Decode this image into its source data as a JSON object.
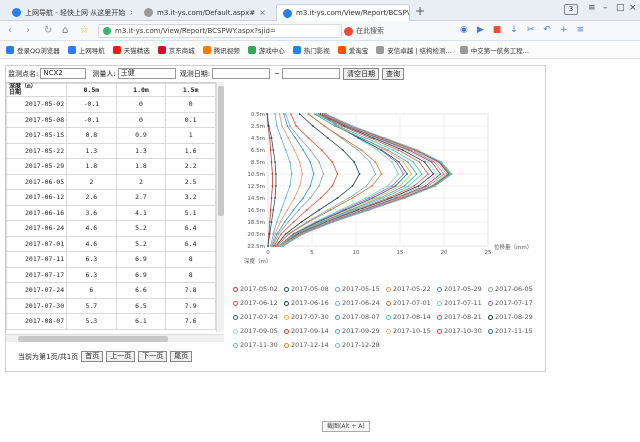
{
  "browser": {
    "tabs": [
      {
        "label": "上网导航 - 轻快上网 从这里开始",
        "icon": "globe-icon",
        "color": "#2b7de9"
      },
      {
        "label": "m3.it-ys.com/Default.aspx#",
        "icon": "page-icon",
        "color": "#777777"
      },
      {
        "label": "m3.it-ys.com/View/Report/BCSPV",
        "icon": "page-icon",
        "color": "#2b7de9"
      }
    ],
    "badge": "3",
    "url": "m3.it-ys.com/View/Report/BCSPWY.aspx?sjid=",
    "search_placeholder": "在此搜索",
    "bookmarks": [
      {
        "label": "登录QQ浏览器",
        "color": "#2b7de9"
      },
      {
        "label": "上网导航",
        "color": "#2b7de9"
      },
      {
        "label": "天猫精选",
        "color": "#e2231a"
      },
      {
        "label": "京东商城",
        "color": "#c81623"
      },
      {
        "label": "腾讯视频",
        "color": "#ff7a00"
      },
      {
        "label": "游戏中心",
        "color": "#34a853"
      },
      {
        "label": "热门影视",
        "color": "#1e88e5"
      },
      {
        "label": "爱淘宝",
        "color": "#ff5000"
      },
      {
        "label": "安信卓越 | 结构检测...",
        "color": "#999999"
      },
      {
        "label": "中交第一航务工程...",
        "color": "#999999"
      }
    ]
  },
  "filter": {
    "site_label": "监测点名:",
    "site_value": "NCX2",
    "measurer_label": "测量人:",
    "measurer_value": "王健",
    "date_label": "观测日期:",
    "date_sep": "~",
    "clear_button": "清空日期",
    "query_button": "查询"
  },
  "table": {
    "corner_top": "深度（m）",
    "corner_bottom": "日期",
    "columns": [
      "0.5m",
      "1.0m",
      "1.5m"
    ],
    "rows": [
      [
        "2017-05-02",
        "-0.1",
        "0",
        "0"
      ],
      [
        "2017-05-08",
        "-0.1",
        "0",
        "0.1"
      ],
      [
        "2017-05-15",
        "0.8",
        "0.9",
        "1"
      ],
      [
        "2017-05-22",
        "1.3",
        "1.3",
        "1.6"
      ],
      [
        "2017-05-29",
        "1.8",
        "1.8",
        "2.2"
      ],
      [
        "2017-06-05",
        "2",
        "2",
        "2.5"
      ],
      [
        "2017-06-12",
        "2.6",
        "2.7",
        "3.2"
      ],
      [
        "2017-06-16",
        "3.6",
        "4.1",
        "5.1"
      ],
      [
        "2017-06-24",
        "4.6",
        "5.2",
        "6.4"
      ],
      [
        "2017-07-01",
        "4.6",
        "5.2",
        "6.4"
      ],
      [
        "2017-07-11",
        "6.3",
        "6.9",
        "8"
      ],
      [
        "2017-07-17",
        "6.3",
        "6.9",
        "8"
      ],
      [
        "2017-07-24",
        "6",
        "6.6",
        "7.8"
      ],
      [
        "2017-07-30",
        "5.7",
        "6.5",
        "7.9"
      ],
      [
        "2017-08-07",
        "5.3",
        "6.1",
        "7.6"
      ]
    ]
  },
  "pager": {
    "info": "当前为第1页/共1页",
    "first": "首页",
    "prev": "上一页",
    "next": "下一页",
    "last": "尾页"
  },
  "chart_data": {
    "type": "line",
    "xlabel": "位移量（mm）",
    "ylabel": "深度（m）",
    "x_ticks": [
      "0",
      "5",
      "10",
      "15",
      "20",
      "25"
    ],
    "y_ticks": [
      "0.5m",
      "2.5m",
      "4.5m",
      "6.5m",
      "8.5m",
      "10.5m",
      "12.5m",
      "14.5m",
      "16.5m",
      "18.5m",
      "20.5m",
      "22.5m"
    ],
    "xlim": [
      0,
      25
    ],
    "ylim": [
      0.5,
      22.5
    ],
    "grid": true,
    "depths": [
      0.5,
      2.5,
      4.5,
      6.5,
      8.5,
      10.5,
      12.5,
      14.5,
      16.5,
      18.5,
      20.5,
      22.5
    ],
    "series": [
      {
        "name": "2017-05-02",
        "color": "#c0392b",
        "values": [
          -0.1,
          0,
          0.2,
          0.3,
          0.4,
          0.5,
          0.5,
          0.4,
          0.3,
          0.2,
          0.1,
          0
        ]
      },
      {
        "name": "2017-05-08",
        "color": "#34495e",
        "values": [
          -0.1,
          0.1,
          0.4,
          0.6,
          0.8,
          0.9,
          0.9,
          0.8,
          0.6,
          0.4,
          0.2,
          0
        ]
      },
      {
        "name": "2017-05-15",
        "color": "#5dade2",
        "values": [
          0.8,
          1,
          1.5,
          2,
          2.5,
          2.7,
          2.5,
          2,
          1.5,
          1,
          0.6,
          0.3
        ]
      },
      {
        "name": "2017-05-22",
        "color": "#e59866",
        "values": [
          1.3,
          1.6,
          2.3,
          3,
          3.6,
          3.9,
          3.6,
          3,
          2.2,
          1.4,
          0.8,
          0.4
        ]
      },
      {
        "name": "2017-05-29",
        "color": "#3498db",
        "values": [
          1.8,
          2.2,
          3.1,
          4,
          4.8,
          5.2,
          4.8,
          4,
          2.9,
          1.9,
          1,
          0.5
        ]
      },
      {
        "name": "2017-06-05",
        "color": "#95a5a6",
        "values": [
          2,
          2.5,
          3.6,
          4.8,
          5.8,
          6.3,
          5.8,
          4.8,
          3.5,
          2.3,
          1.2,
          0.6
        ]
      },
      {
        "name": "2017-06-12",
        "color": "#e74c3c",
        "values": [
          2.6,
          3.2,
          4.6,
          6.1,
          7.3,
          7.9,
          7.3,
          6,
          4.4,
          2.9,
          1.5,
          0.7
        ]
      },
      {
        "name": "2017-06-16",
        "color": "#2c3e50",
        "values": [
          3.6,
          5.1,
          6.8,
          8.5,
          9.8,
          10.4,
          9.6,
          7.9,
          5.8,
          3.8,
          2,
          0.9
        ]
      },
      {
        "name": "2017-06-24",
        "color": "#7fb3d5",
        "values": [
          4.6,
          6.4,
          8.3,
          10.2,
          11.6,
          12.2,
          11.2,
          9.2,
          6.8,
          4.4,
          2.3,
          1
        ]
      },
      {
        "name": "2017-07-01",
        "color": "#dc7633",
        "values": [
          4.6,
          6.4,
          8.5,
          10.6,
          12.2,
          12.9,
          11.8,
          9.6,
          7.1,
          4.6,
          2.4,
          1
        ]
      },
      {
        "name": "2017-07-11",
        "color": "#76d7c4",
        "values": [
          6.3,
          8,
          10.2,
          12.4,
          14.1,
          14.8,
          13.6,
          11.1,
          8.2,
          5.3,
          2.8,
          1.2
        ]
      },
      {
        "name": "2017-07-17",
        "color": "#a569bd",
        "values": [
          6.3,
          8,
          10.4,
          12.8,
          14.6,
          15.4,
          14.1,
          11.5,
          8.5,
          5.5,
          2.9,
          1.2
        ]
      },
      {
        "name": "2017-07-24",
        "color": "#1f618d",
        "values": [
          6,
          7.8,
          10.3,
          12.9,
          14.9,
          15.8,
          14.5,
          11.9,
          8.8,
          5.7,
          3,
          1.3
        ]
      },
      {
        "name": "2017-07-30",
        "color": "#f5b041",
        "values": [
          5.7,
          7.9,
          10.6,
          13.3,
          15.4,
          16.3,
          15,
          12.3,
          9.1,
          5.9,
          3.1,
          1.3
        ]
      },
      {
        "name": "2017-08-07",
        "color": "#5499c7",
        "values": [
          5.3,
          7.6,
          10.6,
          13.6,
          15.9,
          16.9,
          15.5,
          12.7,
          9.4,
          6.1,
          3.2,
          1.4
        ]
      },
      {
        "name": "2017-08-14",
        "color": "#48c9b0",
        "values": [
          5.5,
          8,
          11.1,
          14.2,
          16.5,
          17.5,
          16,
          13.1,
          9.7,
          6.3,
          3.3,
          1.4
        ]
      },
      {
        "name": "2017-08-21",
        "color": "#cd6155",
        "values": [
          5.8,
          8.4,
          11.6,
          14.8,
          17.2,
          18.2,
          16.6,
          13.6,
          10,
          6.5,
          3.4,
          1.5
        ]
      },
      {
        "name": "2017-08-29",
        "color": "#273746",
        "values": [
          6,
          8.7,
          12,
          15.3,
          17.8,
          18.8,
          17.1,
          14,
          10.3,
          6.7,
          3.5,
          1.5
        ]
      },
      {
        "name": "2017-09-05",
        "color": "#a9cce3",
        "values": [
          6.1,
          8.9,
          12.3,
          15.7,
          18.2,
          19.2,
          17.5,
          14.3,
          10.5,
          6.8,
          3.6,
          1.5
        ]
      },
      {
        "name": "2017-09-14",
        "color": "#c0392b",
        "values": [
          6.2,
          9,
          12.5,
          16,
          18.6,
          19.6,
          17.9,
          14.6,
          10.8,
          7,
          3.7,
          1.6
        ]
      },
      {
        "name": "2017-09-29",
        "color": "#5dade2",
        "values": [
          6.3,
          9.2,
          12.7,
          16.3,
          18.9,
          20,
          18.2,
          14.9,
          11,
          7.1,
          3.8,
          1.6
        ]
      },
      {
        "name": "2017-10-15",
        "color": "#f0b27a",
        "values": [
          6.4,
          9.3,
          12.9,
          16.5,
          19.2,
          20.3,
          18.5,
          15.1,
          11.2,
          7.2,
          3.8,
          1.6
        ]
      },
      {
        "name": "2017-10-30",
        "color": "#e74c3c",
        "values": [
          6.5,
          9.4,
          13,
          16.7,
          19.4,
          20.5,
          18.7,
          15.3,
          11.3,
          7.3,
          3.9,
          1.7
        ]
      },
      {
        "name": "2017-11-15",
        "color": "#2874a6",
        "values": [
          6.5,
          9.5,
          13.1,
          16.8,
          19.5,
          20.6,
          18.8,
          15.4,
          11.4,
          7.3,
          3.9,
          1.7
        ]
      },
      {
        "name": "2017-11-30",
        "color": "#48c9b0",
        "values": [
          6.6,
          9.5,
          13.2,
          16.9,
          19.6,
          20.7,
          18.9,
          15.5,
          11.4,
          7.4,
          3.9,
          1.7
        ]
      },
      {
        "name": "2017-12-14",
        "color": "#e67e22",
        "values": [
          6.6,
          9.6,
          13.2,
          16.9,
          19.7,
          20.8,
          19,
          15.5,
          11.5,
          7.4,
          3.9,
          1.7
        ]
      },
      {
        "name": "2017-12-28",
        "color": "#7fb3d5",
        "values": [
          6.6,
          9.6,
          13.3,
          17,
          19.7,
          20.9,
          19,
          15.6,
          11.5,
          7.4,
          4,
          1.7
        ]
      }
    ]
  },
  "tooltip": "截图(Alt + A)"
}
